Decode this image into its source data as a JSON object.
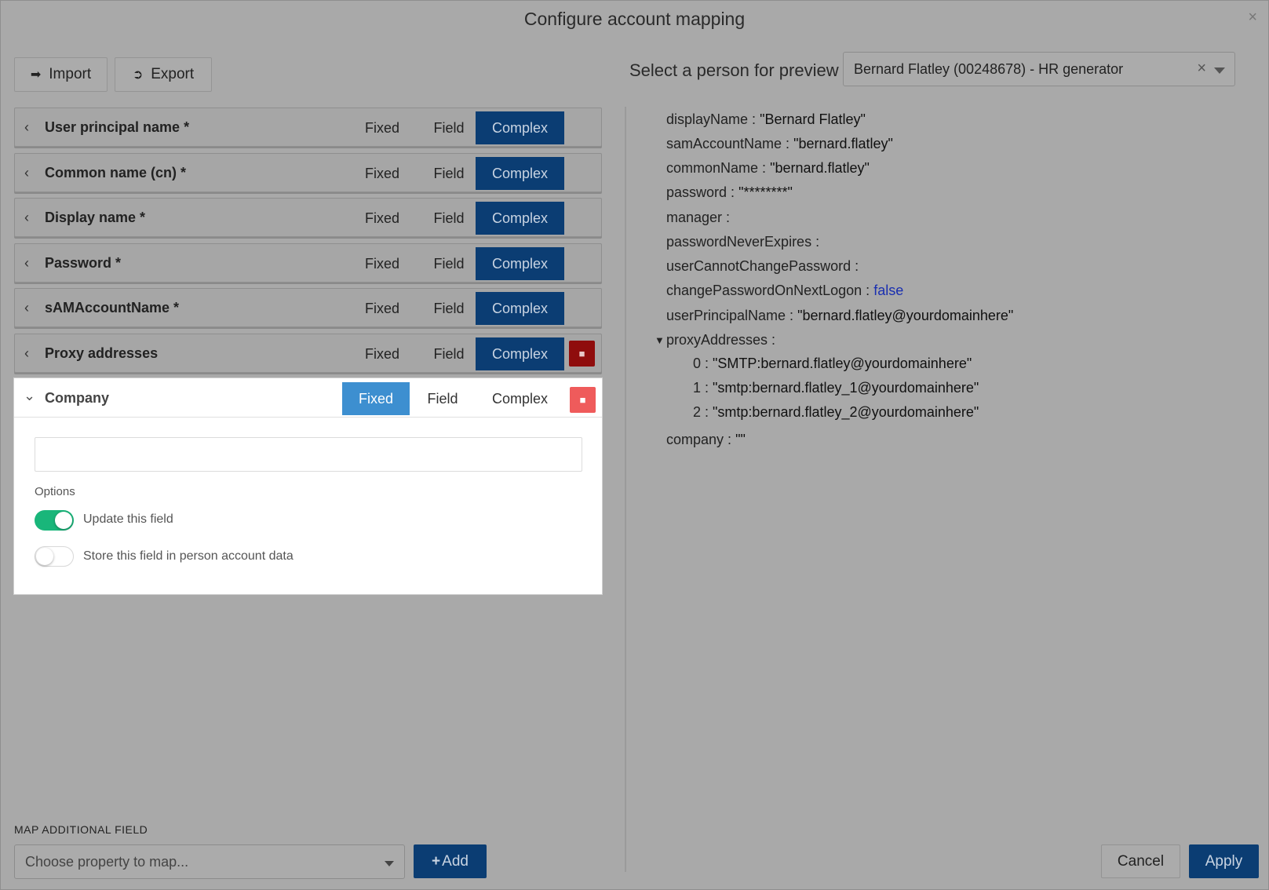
{
  "dialog": {
    "title": "Configure account mapping",
    "close": "×"
  },
  "toolbar": {
    "import_label": "Import",
    "export_label": "Export"
  },
  "preview": {
    "label": "Select a person for preview",
    "selected_person": "Bernard Flatley (00248678) - HR generator",
    "clear": "×"
  },
  "mappings": [
    {
      "label": "User principal name *",
      "mode": "Complex"
    },
    {
      "label": "Common name (cn) *",
      "mode": "Complex"
    },
    {
      "label": "Display name *",
      "mode": "Complex"
    },
    {
      "label": "Password *",
      "mode": "Complex"
    },
    {
      "label": "sAMAccountName *",
      "mode": "Complex"
    },
    {
      "label": "Proxy addresses",
      "mode": "Complex"
    }
  ],
  "modes": {
    "fixed": "Fixed",
    "field": "Field",
    "complex": "Complex"
  },
  "expanded": {
    "label": "Company",
    "mode": "Fixed",
    "value": "",
    "options_label": "Options",
    "update_field_label": "Update this field",
    "update_field_on": true,
    "store_field_label": "Store this field in person account data",
    "store_field_on": false
  },
  "bottom": {
    "map_label": "MAP ADDITIONAL FIELD",
    "map_placeholder": "Choose property to map...",
    "add_label": "Add",
    "cancel_label": "Cancel",
    "apply_label": "Apply"
  },
  "preview_tree": {
    "displayName": {
      "key": "displayName :",
      "value": "\"Bernard Flatley\""
    },
    "samAccountName": {
      "key": "samAccountName :",
      "value": "\"bernard.flatley\""
    },
    "commonName": {
      "key": "commonName :",
      "value": "\"bernard.flatley\""
    },
    "password": {
      "key": "password :",
      "value": "\"********\""
    },
    "manager": {
      "key": "manager :",
      "value": ""
    },
    "passwordNeverExpires": {
      "key": "passwordNeverExpires :",
      "value": ""
    },
    "userCannotChangePassword": {
      "key": "userCannotChangePassword :",
      "value": ""
    },
    "changePasswordOnNextLogon": {
      "key": "changePasswordOnNextLogon :",
      "value": "false"
    },
    "userPrincipalName": {
      "key": "userPrincipalName :",
      "value": "\"bernard.flatley@yourdomainhere\""
    },
    "proxyAddresses": {
      "key": "proxyAddresses :",
      "toggle": "▼"
    },
    "proxy_items": [
      {
        "key": "0 :",
        "value": "\"SMTP:bernard.flatley@yourdomainhere\""
      },
      {
        "key": "1 :",
        "value": "\"smtp:bernard.flatley_1@yourdomainhere\""
      },
      {
        "key": "2 :",
        "value": "\"smtp:bernard.flatley_2@yourdomainhere\""
      }
    ],
    "company": {
      "key": "company :",
      "value": "\"\""
    }
  },
  "colors": {
    "accent": "#0b3d73",
    "fixed_active": "#3d8fd0",
    "toggle_on": "#19b67a",
    "delete_active": "#ef5b5b",
    "bool_value": "#1a2fb0"
  }
}
